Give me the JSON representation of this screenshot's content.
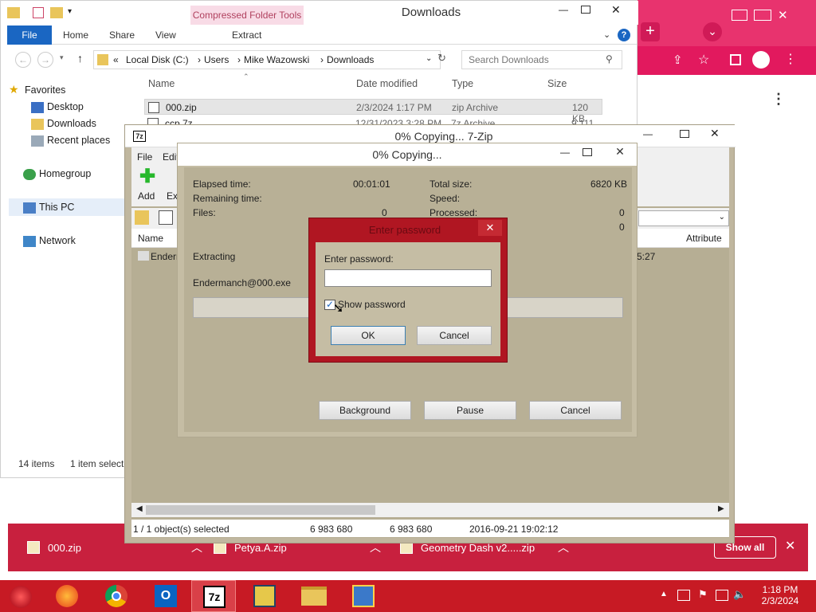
{
  "explorer": {
    "title": "Downloads",
    "contextual_tab": "Compressed Folder Tools",
    "ribbon": {
      "file": "File",
      "home": "Home",
      "share": "Share",
      "view": "View",
      "extract": "Extract"
    },
    "address": {
      "prefix": "«",
      "segments": [
        "Local Disk (C:)",
        "Users",
        "Mike Wazowski",
        "Downloads"
      ]
    },
    "search_placeholder": "Search Downloads",
    "nav": {
      "favorites": "Favorites",
      "desktop": "Desktop",
      "downloads": "Downloads",
      "recent": "Recent places",
      "homegroup": "Homegroup",
      "thispc": "This PC",
      "network": "Network"
    },
    "columns": {
      "name": "Name",
      "date": "Date modified",
      "type": "Type",
      "size": "Size"
    },
    "files": [
      {
        "name": "000.zip",
        "date": "2/3/2024 1:17 PM",
        "type": "zip Archive",
        "size": "120 KB"
      },
      {
        "name": "ccp.7z",
        "date": "12/31/2023 3:28 PM",
        "type": "7z Archive",
        "size": "9,111 KB"
      }
    ],
    "status": {
      "items": "14 items",
      "selected": "1 item selecte"
    }
  },
  "zip_window": {
    "title": "0% Copying... 7-Zip",
    "menu": {
      "file": "File",
      "edit": "Edit"
    },
    "toolbar": {
      "add": "Add",
      "extract": "Ext"
    },
    "columns": {
      "name": "Name",
      "attributes": "Attribute"
    },
    "row": {
      "name": "Enderm",
      "time": "5:27"
    },
    "statusbar": {
      "selected": "1 / 1 object(s) selected",
      "size1": "6 983 680",
      "size2": "6 983 680",
      "date": "2016-09-21 19:02:12"
    }
  },
  "progress": {
    "title": "0% Copying...",
    "elapsed_label": "Elapsed time:",
    "elapsed_value": "00:01:01",
    "remaining_label": "Remaining time:",
    "files_label": "Files:",
    "files_value": "0",
    "total_label": "Total size:",
    "total_value": "6820 KB",
    "speed_label": "Speed:",
    "processed_label": "Processed:",
    "processed_value": "0",
    "extra_value": "0",
    "extracting_label": "Extracting",
    "current_file": "Endermanch@000.exe",
    "progress_fraction": 0,
    "buttons": {
      "background": "Background",
      "pause": "Pause",
      "cancel": "Cancel"
    }
  },
  "password_dialog": {
    "title": "Enter password",
    "prompt": "Enter password:",
    "password_value": "",
    "show_password_label": "Show password",
    "show_password_checked": true,
    "ok": "OK",
    "cancel": "Cancel"
  },
  "downloads_bar": {
    "items": [
      "000.zip",
      "Petya.A.zip",
      "Geometry Dash v2.....zip"
    ],
    "show_all": "Show all"
  },
  "taskbar": {
    "time": "1:18 PM",
    "date": "2/3/2024"
  },
  "colors": {
    "accent_red": "#c71a24",
    "chrome_pink": "#e8336e",
    "zip_bg": "#b6ae94"
  }
}
